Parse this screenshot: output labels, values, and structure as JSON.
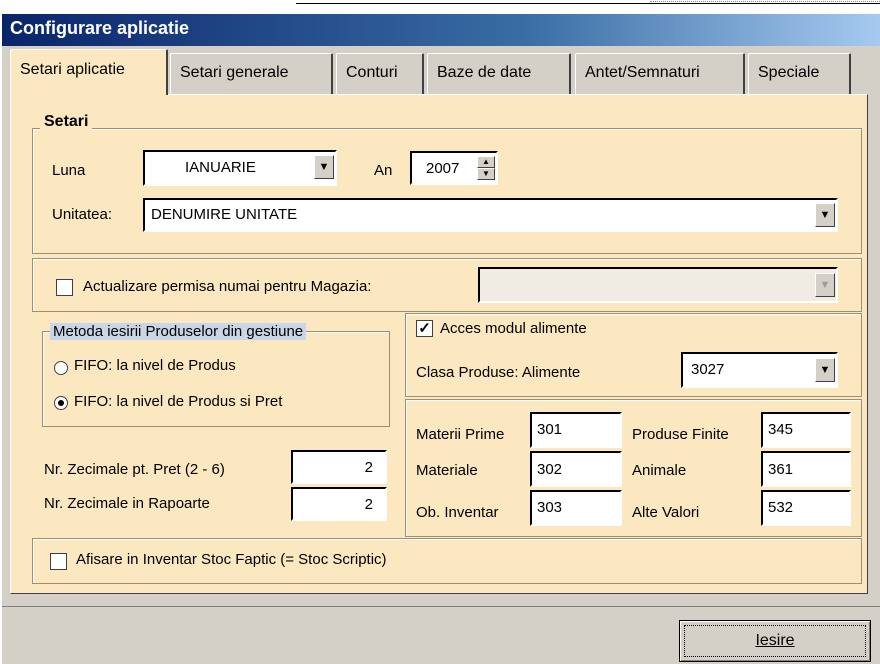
{
  "window": {
    "title": "Configurare aplicatie"
  },
  "tabs": [
    "Setari aplicatie",
    "Setari generale",
    "Conturi",
    "Baze de date",
    "Antet/Semnaturi",
    "Speciale"
  ],
  "setari": {
    "legend": "Setari",
    "luna_label": "Luna",
    "luna_value": "IANUARIE",
    "an_label": "An",
    "an_value": "2007",
    "unitatea_label": "Unitatea:",
    "unitatea_value": "DENUMIRE UNITATE"
  },
  "magazia": {
    "label": "Actualizare permisa numai pentru Magazia:",
    "checked": false,
    "value": ""
  },
  "metoda": {
    "legend": "Metoda iesirii Produselor din gestiune",
    "options": [
      "FIFO: la nivel de Produs",
      "FIFO: la nivel de Produs si Pret"
    ],
    "selected_index": 1
  },
  "zecimale": {
    "pret_label": "Nr. Zecimale pt. Pret (2 - 6)",
    "pret_value": "2",
    "rapoarte_label": "Nr. Zecimale in Rapoarte",
    "rapoarte_value": "2"
  },
  "alimente": {
    "acces_label": "Acces modul  alimente",
    "acces_checked": true,
    "clasa_label": "Clasa Produse: Alimente",
    "clasa_value": "3027"
  },
  "conturi": {
    "materii_prime_label": "Materii Prime",
    "materii_prime_value": "301",
    "materiale_label": "Materiale",
    "materiale_value": "302",
    "ob_inventar_label": "Ob. Inventar",
    "ob_inventar_value": "303",
    "produse_finite_label": "Produse Finite",
    "produse_finite_value": "345",
    "animale_label": "Animale",
    "animale_value": "361",
    "alte_valori_label": "Alte Valori",
    "alte_valori_value": "532"
  },
  "afisare": {
    "label": "Afisare in Inventar Stoc Faptic (= Stoc Scriptic)",
    "checked": false
  },
  "buttons": {
    "iesire": "Iesire"
  },
  "icons": {
    "dropdown": "chevron-down-icon",
    "spin": "spin-updown-icon",
    "check": "checkmark-icon"
  }
}
